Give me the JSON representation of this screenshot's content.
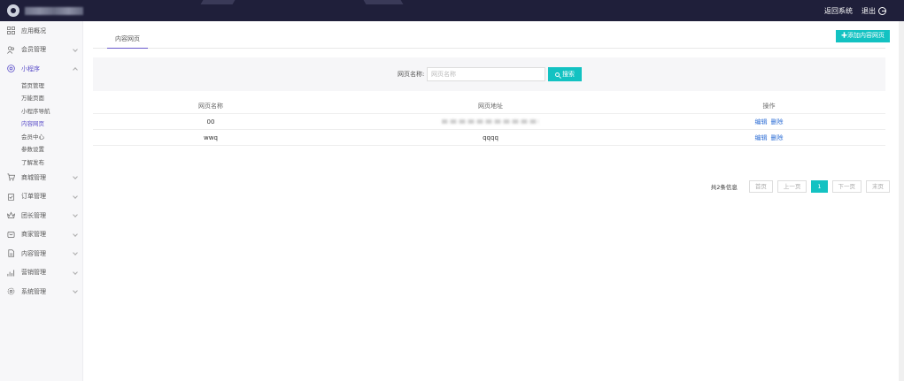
{
  "topbar": {
    "back_label": "返回系统",
    "logout_label": "退出"
  },
  "sidebar": {
    "items": [
      {
        "label": "应用概况",
        "icon": "grid-icon",
        "chevron": false
      },
      {
        "label": "会员管理",
        "icon": "users-icon",
        "chevron": true
      },
      {
        "label": "小程序",
        "icon": "miniapp-icon",
        "chevron": true,
        "expanded": true,
        "active": true,
        "children": [
          "首页管理",
          "万能页面",
          "小程序导航",
          "内容网页",
          "会员中心",
          "参数设置",
          "了解发布"
        ],
        "active_child": 3
      },
      {
        "label": "商城管理",
        "icon": "cart-icon",
        "chevron": true
      },
      {
        "label": "订单管理",
        "icon": "clipboard-icon",
        "chevron": true
      },
      {
        "label": "团长管理",
        "icon": "crown-icon",
        "chevron": true
      },
      {
        "label": "商家管理",
        "icon": "store-icon",
        "chevron": true
      },
      {
        "label": "内容管理",
        "icon": "document-icon",
        "chevron": true
      },
      {
        "label": "营销管理",
        "icon": "chart-icon",
        "chevron": true
      },
      {
        "label": "系统管理",
        "icon": "gear-icon",
        "chevron": true
      }
    ]
  },
  "main": {
    "tab_label": "内容网页",
    "add_button_label": "添加内容网页",
    "search": {
      "label": "网页名称:",
      "placeholder": "网页名称",
      "button_label": "搜索"
    },
    "table": {
      "headers": [
        "网页名称",
        "网页地址",
        "操作"
      ],
      "rows": [
        {
          "name": "00",
          "url": "",
          "url_blurred": true,
          "actions": [
            "编辑",
            "删除"
          ]
        },
        {
          "name": "wwq",
          "url": "qqqq",
          "url_blurred": false,
          "actions": [
            "编辑",
            "删除"
          ]
        }
      ]
    },
    "pager": {
      "total_text": "共2条信息",
      "first": "首页",
      "prev": "上一页",
      "current": "1",
      "next": "下一页",
      "last": "末页"
    }
  },
  "colors": {
    "topbar_bg": "#1f1f3a",
    "accent": "#13c2c2",
    "active_menu": "#5b4ec9",
    "link": "#2f6fd6"
  }
}
